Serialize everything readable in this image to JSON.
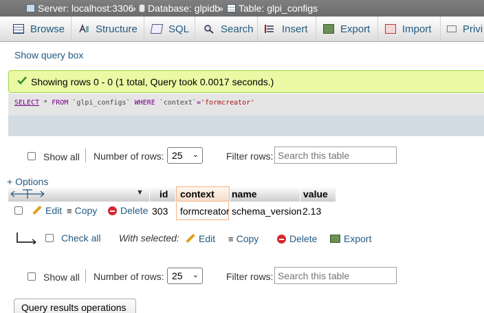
{
  "breadcrumb": {
    "server": "Server: localhost:3306",
    "database": "Database: glpidb",
    "table": "Table: glpi_configs",
    "sep": "»"
  },
  "tabs": [
    {
      "label": "Browse",
      "icon": "browse-icon"
    },
    {
      "label": "Structure",
      "icon": "structure-icon"
    },
    {
      "label": "SQL",
      "icon": "sql-icon"
    },
    {
      "label": "Search",
      "icon": "search-icon"
    },
    {
      "label": "Insert",
      "icon": "insert-icon"
    },
    {
      "label": "Export",
      "icon": "export-icon"
    },
    {
      "label": "Import",
      "icon": "import-icon"
    },
    {
      "label": "Privi",
      "icon": "privileges-icon"
    }
  ],
  "show_query_box": "Show query box",
  "success_message": "Showing rows 0 - 0 (1 total, Query took 0.0017 seconds.)",
  "sql": {
    "select": "SELECT",
    "star": " * ",
    "from": "FROM",
    "table": " `glpi_configs` ",
    "where": "WHERE",
    "cond_col": " `context`",
    "cond_eq": "=",
    "cond_val": "'formcreator'"
  },
  "nav": {
    "show_all": "Show all",
    "number_of_rows": "Number of rows:",
    "rows_value": "25",
    "filter_rows": "Filter rows:",
    "search_placeholder": "Search this table"
  },
  "options_link": "+ Options",
  "table": {
    "columns": [
      "id",
      "context",
      "name",
      "value"
    ],
    "rows": [
      {
        "id": "303",
        "context": "formcreator",
        "name": "schema_version",
        "value": "2.13"
      }
    ],
    "row_actions": {
      "edit": "Edit",
      "copy": "Copy",
      "delete": "Delete"
    }
  },
  "bulk": {
    "check_all": "Check all",
    "with_selected": "With selected:",
    "edit": "Edit",
    "copy": "Copy",
    "delete": "Delete",
    "export": "Export"
  },
  "bottom_partial": "Query results operations",
  "colors": {
    "link": "#235a81",
    "success_bg": "#ebf8a4",
    "success_border": "#a2d246",
    "sql_bg": "#e5e5e5",
    "topbar": "#777777"
  }
}
